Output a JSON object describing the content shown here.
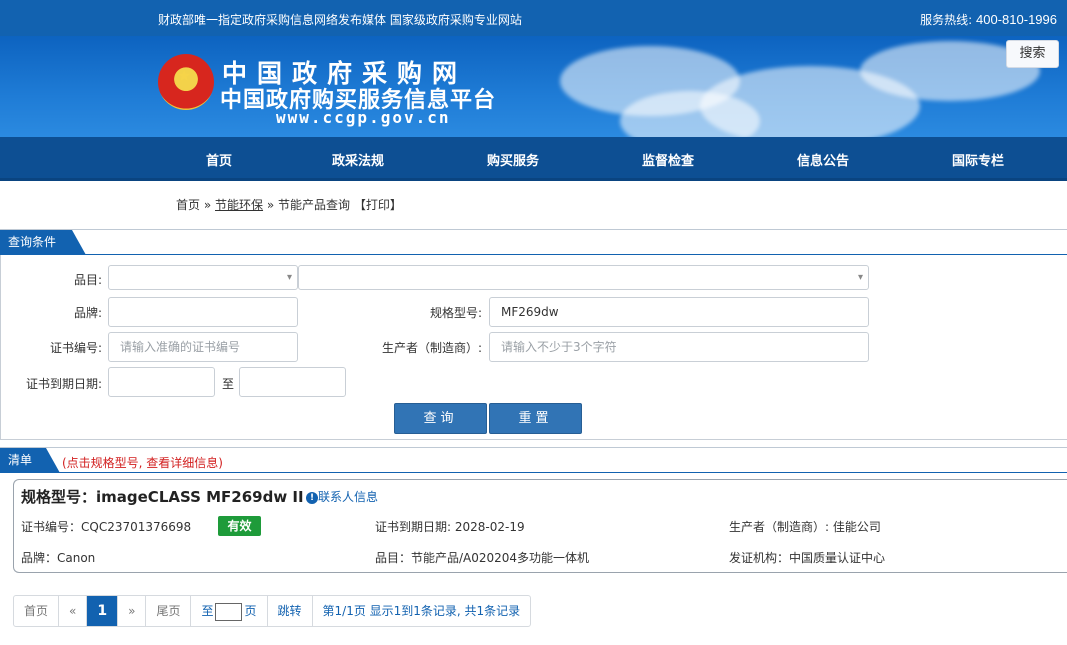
{
  "topbar": {
    "slogan": "财政部唯一指定政府采购信息网络发布媒体 国家级政府采购专业网站",
    "hotline_label": "服务热线:",
    "hotline_number": "400-810-1996"
  },
  "banner": {
    "site_name": "中国政府采购网",
    "site_subtitle": "中国政府购买服务信息平台",
    "url": "www.ccgp.gov.cn",
    "search_button": "搜索"
  },
  "nav": {
    "items": [
      "首页",
      "政采法规",
      "购买服务",
      "监督检查",
      "信息公告",
      "国际专栏"
    ]
  },
  "breadcrumb": {
    "home": "首页",
    "sep1": "»",
    "section": "节能环保",
    "sep2": "»",
    "current": "节能产品查询",
    "print": "【打印】"
  },
  "query_panel": {
    "tab": "查询条件",
    "category_label": "品目:",
    "category_value_1": "",
    "category_value_2": "",
    "brand_label": "品牌:",
    "brand_value": "",
    "model_label": "规格型号:",
    "model_value": "MF269dw",
    "cert_no_label": "证书编号:",
    "cert_no_placeholder": "请输入准确的证书编号",
    "manufacturer_label": "生产者（制造商）:",
    "manufacturer_placeholder": "请输入不少于3个字符",
    "expiry_label": "证书到期日期:",
    "expiry_from": "",
    "expiry_to_label": "至",
    "expiry_to": "",
    "query_button": "查询",
    "reset_button": "重置"
  },
  "list_panel": {
    "tab": "清单",
    "hint": "(点击规格型号, 查看详细信息)"
  },
  "result": {
    "model_title": "规格型号：imageCLASS MF269dw II",
    "contact_link": "联系人信息",
    "cert_no": "证书编号：CQC23701376698",
    "status": "有效",
    "expiry": "证书到期日期: 2028-02-19",
    "manufacturer": "生产者（制造商）: 佳能公司",
    "brand": "品牌：Canon",
    "category": "品目：节能产品/A020204多功能一体机",
    "issuer": "发证机构：中国质量认证中心"
  },
  "pagination": {
    "first": "首页",
    "prev": "«",
    "current": "1",
    "next": "»",
    "last": "尾页",
    "goto_prefix": "至",
    "goto_suffix": "页",
    "jump": "跳转",
    "summary": "第1/1页  显示1到1条记录, 共1条记录"
  },
  "colors": {
    "brand_blue": "#1262b0",
    "nav_blue": "#0d4f93",
    "status_green": "#1e9b3a",
    "hint_red": "#d21f1f"
  }
}
